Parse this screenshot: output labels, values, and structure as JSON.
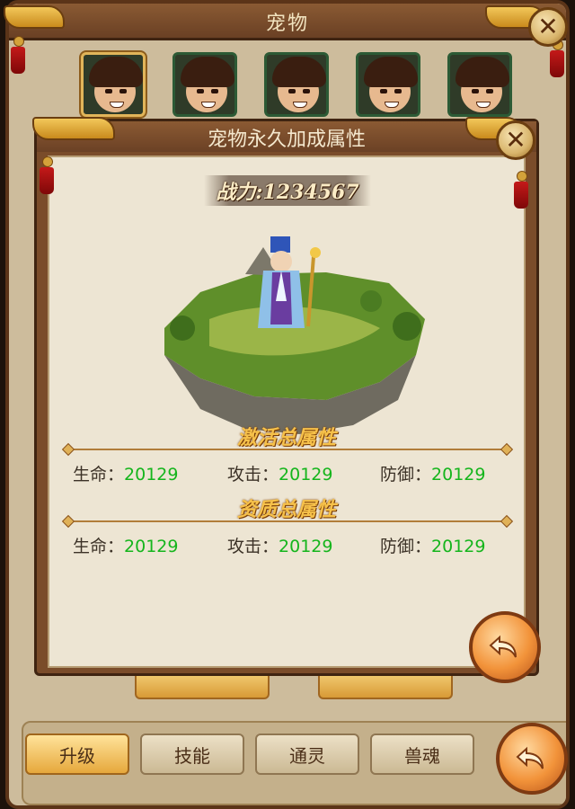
{
  "outer": {
    "title": "宠物",
    "portraits": [
      {
        "selected": true
      },
      {
        "selected": false
      },
      {
        "selected": false
      },
      {
        "selected": false
      },
      {
        "selected": false
      }
    ],
    "tabs": [
      {
        "label": "升级",
        "active": true
      },
      {
        "label": "技能",
        "active": false
      },
      {
        "label": "通灵",
        "active": false
      },
      {
        "label": "兽魂",
        "active": false
      }
    ]
  },
  "modal": {
    "title": "宠物永久加成属性",
    "power": "战力:1234567",
    "sections": [
      {
        "title": "激活总属性",
        "stats": [
          {
            "label": "生命：",
            "value": "20129"
          },
          {
            "label": "攻击：",
            "value": "20129"
          },
          {
            "label": "防御：",
            "value": "20129"
          }
        ]
      },
      {
        "title": "资质总属性",
        "stats": [
          {
            "label": "生命：",
            "value": "20129"
          },
          {
            "label": "攻击：",
            "value": "20129"
          },
          {
            "label": "防御：",
            "value": "20129"
          }
        ]
      }
    ]
  },
  "colors": {
    "stat_value": "#15b51c",
    "section_title": "#f6c14a",
    "panel_bg": "#ede5d3",
    "frame": "#7a4c2a"
  },
  "icons": [
    "close-icon",
    "return-icon",
    "pet-portrait",
    "island-illustration"
  ]
}
